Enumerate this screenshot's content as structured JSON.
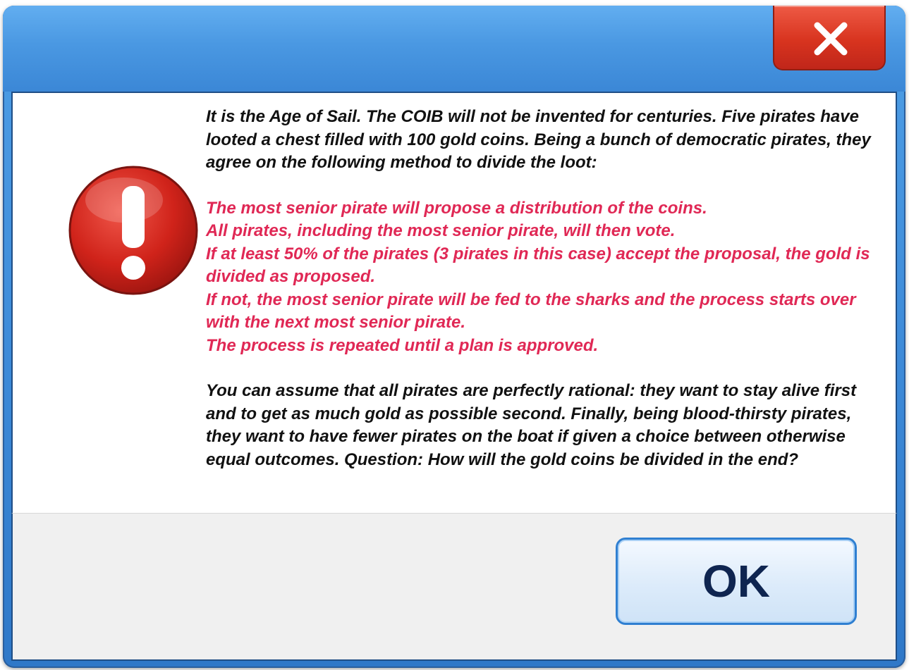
{
  "dialog": {
    "close_icon": "close-icon",
    "error_icon": "exclamation-icon",
    "intro_text": "It is the Age of Sail. The COIB will not be invented for centuries. Five pirates have looted a chest filled with 100 gold coins. Being a bunch of democratic pirates, they agree on the following method to divide the loot:",
    "rules": [
      "The most senior pirate will propose a distribution of the coins.",
      "All pirates, including the most senior pirate, will then vote.",
      "If at least 50% of the pirates (3 pirates in this case) accept the proposal, the gold is divided as proposed.",
      "If not, the most senior pirate will be fed to the sharks and the process starts over with the next most senior pirate.",
      "The process is repeated until a plan is approved."
    ],
    "closing_text": "You can assume that all pirates are perfectly rational: they want to stay alive first and to get as much gold as possible second. Finally, being blood-thirsty pirates, they want to have fewer pirates on the boat if given a choice between otherwise equal outcomes. Question: How will the gold coins be divided in the end?",
    "ok_label": "OK"
  },
  "colors": {
    "title_bar": "#4a98e2",
    "close_button": "#d8341f",
    "rules_text": "#e02855",
    "ok_border": "#2f7fd1"
  }
}
